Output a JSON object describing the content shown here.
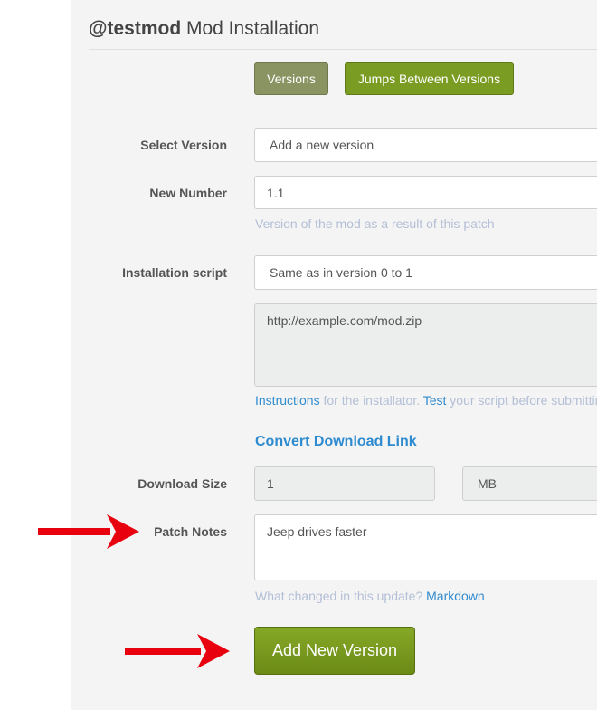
{
  "header": {
    "title_bold": "@testmod",
    "title_rest": "Mod Installation"
  },
  "toggle": {
    "versions_label": "Versions",
    "jumps_label": "Jumps Between Versions"
  },
  "form": {
    "select_version": {
      "label": "Select Version",
      "value": "Add a new version"
    },
    "new_number": {
      "label": "New Number",
      "value": "1.1",
      "help": "Version of the mod as a result of this patch"
    },
    "installation_script": {
      "label": "Installation script",
      "value": "Same as in version 0 to 1",
      "script_text": "http://example.com/mod.zip",
      "help": {
        "instructions_link": "Instructions",
        "mid_text": " for the installator. ",
        "test_link": "Test",
        "tail_text": " your script before submitting."
      }
    },
    "convert_link": "Convert Download Link",
    "download_size": {
      "label": "Download Size",
      "value": "1",
      "unit": "MB"
    },
    "patch_notes": {
      "label": "Patch Notes",
      "value": "Jeep drives faster",
      "help_text": "What changed in this update? ",
      "help_link": "Markdown"
    },
    "submit_label": "Add New Version"
  },
  "colors": {
    "annotation_arrow": "#e8000f",
    "link": "#2e8bd0",
    "button_green": "#7b9c22"
  },
  "icons": [
    "red-arrow-icon"
  ]
}
